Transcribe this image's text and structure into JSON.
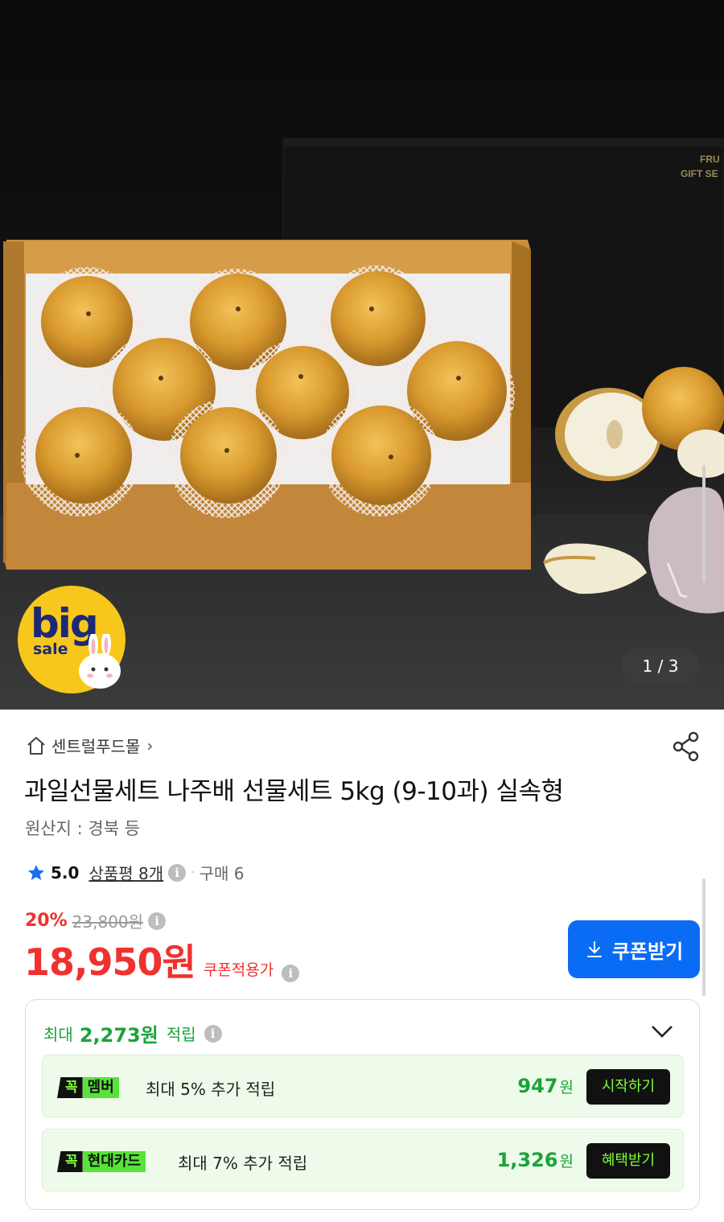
{
  "hero": {
    "pager": "1 / 3",
    "badge_big": "big",
    "badge_sale": "sale",
    "box_label_line1": "FRU",
    "box_label_line2": "GIFT SE"
  },
  "product": {
    "store_name": "센트럴푸드몰",
    "store_chevron": "›",
    "title": "과일선물세트 나주배 선물세트 5kg (9-10과) 실속형",
    "origin": "원산지 : 경북 등",
    "rating": "5.0",
    "review_label": "상품평 8개",
    "purchase_label": "구매 6",
    "discount_rate": "20%",
    "original_price": "23,800원",
    "price": "18,950원",
    "price_label": "쿠폰적용가",
    "coupon_button": "쿠폰받기"
  },
  "reward": {
    "max_label": "최대",
    "max_amount": "2,273원",
    "earn_label": "적립",
    "items": [
      {
        "badge_k": "꼭",
        "badge_name": "멤버",
        "desc": "최대 5% 추가 적립",
        "points": "947",
        "unit": "원",
        "action": "시작하기"
      },
      {
        "badge_k": "꼭",
        "badge_name": "현대카드",
        "desc": "최대 7% 추가 적립",
        "points": "1,326",
        "unit": "원",
        "action": "혜택받기"
      }
    ]
  },
  "colors": {
    "price_red": "#f0312f",
    "coupon_blue": "#0a6cf5",
    "reward_green": "#1aa33a",
    "badge_yellow": "#f7c71c"
  }
}
